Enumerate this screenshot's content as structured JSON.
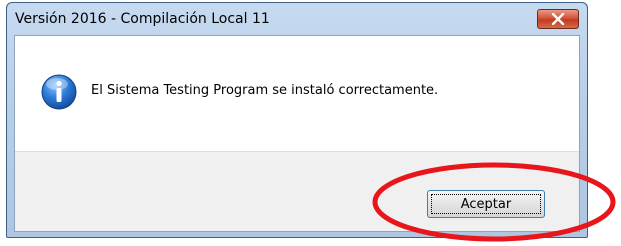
{
  "dialog": {
    "title": "Versión 2016 - Compilación Local 11",
    "message": "El Sistema Testing Program se instaló correctamente.",
    "accept_label": "Aceptar",
    "icon": "info-icon",
    "close_icon": "close-icon"
  },
  "annotation": {
    "shape": "ellipse",
    "color": "#e8151b",
    "highlights": "accept-button"
  },
  "colors": {
    "titlebar": "#b9cfe8",
    "close_button": "#c94a2e",
    "info_icon": "#1f6fc9",
    "button_bar": "#f0f0f0"
  }
}
